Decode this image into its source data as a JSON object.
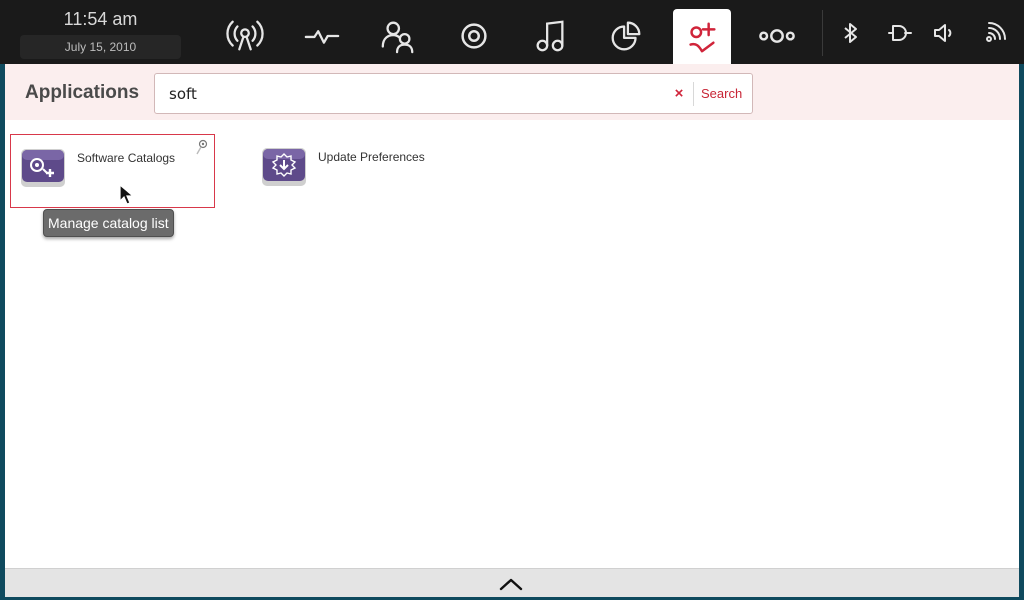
{
  "clock": {
    "time": "11:54 am",
    "date": "July 15, 2010"
  },
  "toolbar": {
    "zones": [
      {
        "name": "broadcast",
        "icon": "broadcast-icon"
      },
      {
        "name": "activity",
        "icon": "pulse-icon"
      },
      {
        "name": "people",
        "icon": "people-icon"
      },
      {
        "name": "target",
        "icon": "target-icon"
      },
      {
        "name": "music",
        "icon": "music-icon"
      },
      {
        "name": "charts",
        "icon": "pie-chart-icon"
      },
      {
        "name": "applications",
        "icon": "apps-add-icon",
        "active": true
      },
      {
        "name": "switcher",
        "icon": "dots-icon"
      }
    ],
    "tray": [
      "bluetooth-icon",
      "battery-icon",
      "volume-icon",
      "wifi-icon"
    ]
  },
  "header": {
    "title": "Applications",
    "search": {
      "value": "soft",
      "clear": "×",
      "button": "Search"
    }
  },
  "apps": [
    {
      "label": "Software Catalogs",
      "icon": "catalog-app-icon",
      "selected": true,
      "tooltip": "Manage catalog list"
    },
    {
      "label": "Update Preferences",
      "icon": "update-app-icon",
      "selected": false
    }
  ],
  "colors": {
    "accent": "#d0243a",
    "toolbar": "#1a1a1a",
    "header": "#fbeeee",
    "icon_purple": "#5e4a8a",
    "bottom_bar": "#e4e4e4"
  }
}
